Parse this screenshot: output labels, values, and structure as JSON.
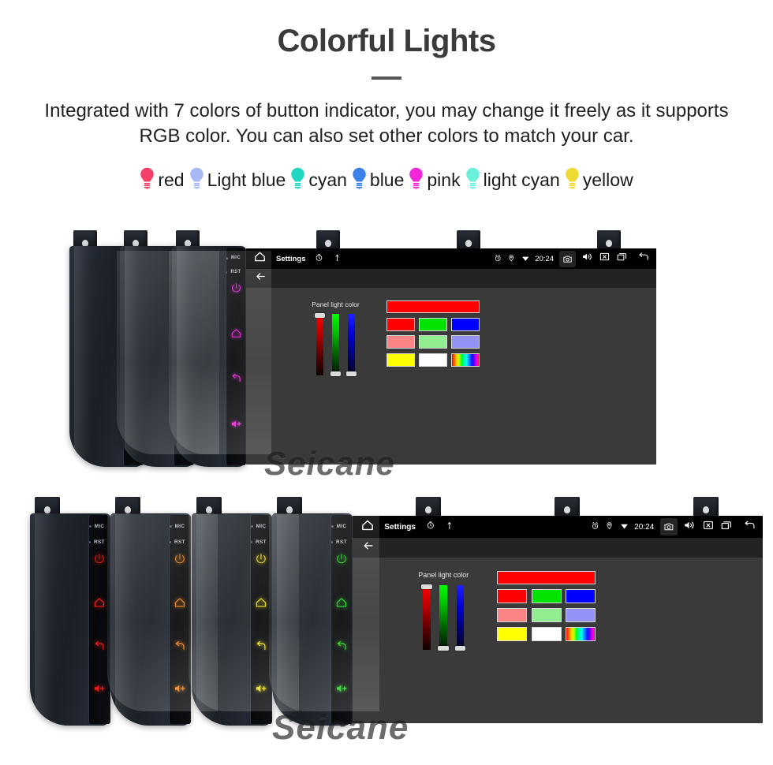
{
  "header": {
    "title": "Colorful Lights",
    "description": "Integrated with 7 colors of button indicator, you may change it freely as it supports RGB color. You can also set other colors to match your car."
  },
  "legend": {
    "items": [
      {
        "label": "red",
        "color": "#f43f68",
        "icon": "bulb-icon"
      },
      {
        "label": "Light blue",
        "color": "#a8b8f5",
        "icon": "bulb-icon"
      },
      {
        "label": "cyan",
        "color": "#22d6c4",
        "icon": "bulb-icon"
      },
      {
        "label": "blue",
        "color": "#3b82e8",
        "icon": "bulb-icon"
      },
      {
        "label": "pink",
        "color": "#f327d7",
        "icon": "bulb-icon"
      },
      {
        "label": "light cyan",
        "color": "#6bf0dc",
        "icon": "bulb-icon"
      },
      {
        "label": "yellow",
        "color": "#f0d933",
        "icon": "bulb-icon"
      }
    ]
  },
  "device": {
    "key_strip": {
      "mic_label": "MIC",
      "rst_label": "RST",
      "keys": [
        {
          "name": "power-key",
          "icon": "power-icon"
        },
        {
          "name": "home-key",
          "icon": "home-icon"
        },
        {
          "name": "back-key",
          "icon": "back-arrow-icon"
        },
        {
          "name": "volume-up-key",
          "icon": "volume-up-icon"
        },
        {
          "name": "volume-down-key",
          "icon": "volume-down-icon"
        }
      ]
    },
    "status_bar": {
      "home_icon": "home-icon",
      "title": "Settings",
      "left_icons": [
        "clock-icon",
        "usb-icon"
      ],
      "right_icons": [
        "alarm-icon",
        "location-icon",
        "wifi-icon"
      ],
      "clock": "20:24",
      "camera_icon": "camera-icon",
      "volume_icon": "volume-icon",
      "close_icon": "close-box-icon",
      "recents_icon": "recents-icon",
      "back_icon": "back-icon"
    },
    "app_bar": {
      "back_icon": "back-arrow-icon"
    },
    "panel": {
      "caption": "Panel light color",
      "sliders": [
        {
          "name": "red-slider",
          "channel": "R",
          "value": 100,
          "handle_position": "top"
        },
        {
          "name": "green-slider",
          "channel": "G",
          "value": 0,
          "handle_position": "bottom"
        },
        {
          "name": "blue-slider",
          "channel": "B",
          "value": 0,
          "handle_position": "bottom"
        }
      ],
      "preview_color": "#ff0000",
      "swatches": [
        [
          "#ff0000",
          "#00e400",
          "#0000ff"
        ],
        [
          "#fb8585",
          "#90ee90",
          "#9292f7"
        ],
        [
          "#ffff00",
          "#ffffff",
          "rainbow"
        ]
      ]
    }
  },
  "stacks": {
    "top_row": {
      "units": [
        {
          "name": "unit-cyan",
          "key_color": "#24d3e8"
        },
        {
          "name": "unit-blue",
          "key_color": "#2a2ae8"
        },
        {
          "name": "unit-magenta",
          "key_color": "#e822d8"
        }
      ]
    },
    "bottom_row": {
      "units": [
        {
          "name": "unit-red",
          "key_color": "#e81c1c"
        },
        {
          "name": "unit-orange",
          "key_color": "#f0801a"
        },
        {
          "name": "unit-yellow",
          "key_color": "#f2e019"
        },
        {
          "name": "unit-green",
          "key_color": "#25d723"
        }
      ]
    }
  },
  "watermark": {
    "text": "Seicane"
  }
}
